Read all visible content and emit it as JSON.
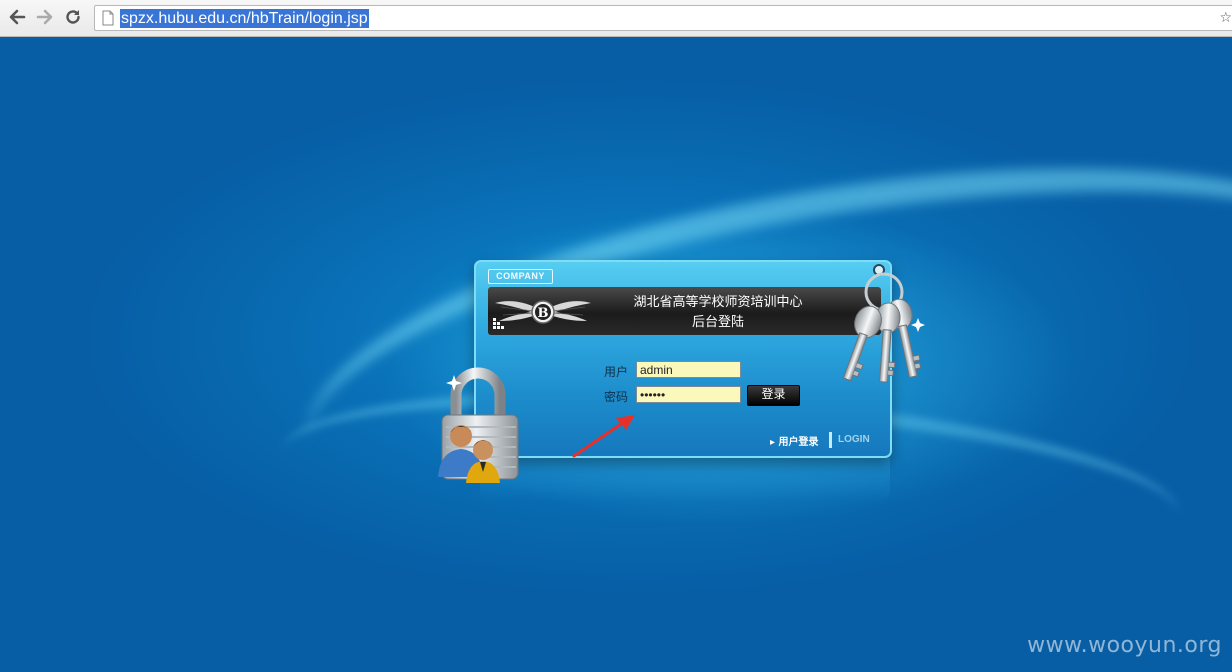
{
  "browser": {
    "url": "spzx.hubu.edu.cn/hbTrain/login.jsp",
    "icons": [
      "back-icon",
      "forward-icon",
      "reload-icon",
      "page-icon"
    ]
  },
  "panel": {
    "company_tag": "COMPANY",
    "title_line1": "湖北省高等学校师资培训中心",
    "title_line2": "后台登陆",
    "username_label": "用户",
    "username_value": "admin",
    "password_label": "密码",
    "password_value": "••••••",
    "login_button": "登录",
    "user_login_link": "▸ 用户登录",
    "login_tab": "LOGIN"
  },
  "watermark": "www.wooyun.org",
  "colors": {
    "background": "#0a64ad",
    "panel": "#2fa9e0",
    "input_bg": "#fbf8bc",
    "button": "#000000",
    "arrow": "#e8302a"
  }
}
